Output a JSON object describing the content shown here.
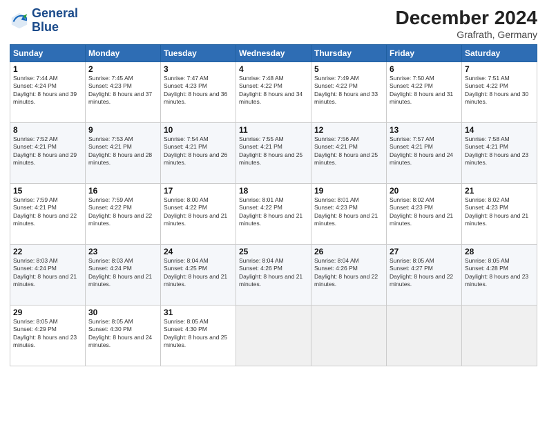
{
  "header": {
    "logo_line1": "General",
    "logo_line2": "Blue",
    "month_year": "December 2024",
    "location": "Grafrath, Germany"
  },
  "days_of_week": [
    "Sunday",
    "Monday",
    "Tuesday",
    "Wednesday",
    "Thursday",
    "Friday",
    "Saturday"
  ],
  "weeks": [
    [
      {
        "day": "1",
        "rise": "7:44 AM",
        "set": "4:24 PM",
        "daylight": "8 hours and 39 minutes."
      },
      {
        "day": "2",
        "rise": "7:45 AM",
        "set": "4:23 PM",
        "daylight": "8 hours and 37 minutes."
      },
      {
        "day": "3",
        "rise": "7:47 AM",
        "set": "4:23 PM",
        "daylight": "8 hours and 36 minutes."
      },
      {
        "day": "4",
        "rise": "7:48 AM",
        "set": "4:22 PM",
        "daylight": "8 hours and 34 minutes."
      },
      {
        "day": "5",
        "rise": "7:49 AM",
        "set": "4:22 PM",
        "daylight": "8 hours and 33 minutes."
      },
      {
        "day": "6",
        "rise": "7:50 AM",
        "set": "4:22 PM",
        "daylight": "8 hours and 31 minutes."
      },
      {
        "day": "7",
        "rise": "7:51 AM",
        "set": "4:22 PM",
        "daylight": "8 hours and 30 minutes."
      }
    ],
    [
      {
        "day": "8",
        "rise": "7:52 AM",
        "set": "4:21 PM",
        "daylight": "8 hours and 29 minutes."
      },
      {
        "day": "9",
        "rise": "7:53 AM",
        "set": "4:21 PM",
        "daylight": "8 hours and 28 minutes."
      },
      {
        "day": "10",
        "rise": "7:54 AM",
        "set": "4:21 PM",
        "daylight": "8 hours and 26 minutes."
      },
      {
        "day": "11",
        "rise": "7:55 AM",
        "set": "4:21 PM",
        "daylight": "8 hours and 25 minutes."
      },
      {
        "day": "12",
        "rise": "7:56 AM",
        "set": "4:21 PM",
        "daylight": "8 hours and 25 minutes."
      },
      {
        "day": "13",
        "rise": "7:57 AM",
        "set": "4:21 PM",
        "daylight": "8 hours and 24 minutes."
      },
      {
        "day": "14",
        "rise": "7:58 AM",
        "set": "4:21 PM",
        "daylight": "8 hours and 23 minutes."
      }
    ],
    [
      {
        "day": "15",
        "rise": "7:59 AM",
        "set": "4:21 PM",
        "daylight": "8 hours and 22 minutes."
      },
      {
        "day": "16",
        "rise": "7:59 AM",
        "set": "4:22 PM",
        "daylight": "8 hours and 22 minutes."
      },
      {
        "day": "17",
        "rise": "8:00 AM",
        "set": "4:22 PM",
        "daylight": "8 hours and 21 minutes."
      },
      {
        "day": "18",
        "rise": "8:01 AM",
        "set": "4:22 PM",
        "daylight": "8 hours and 21 minutes."
      },
      {
        "day": "19",
        "rise": "8:01 AM",
        "set": "4:23 PM",
        "daylight": "8 hours and 21 minutes."
      },
      {
        "day": "20",
        "rise": "8:02 AM",
        "set": "4:23 PM",
        "daylight": "8 hours and 21 minutes."
      },
      {
        "day": "21",
        "rise": "8:02 AM",
        "set": "4:23 PM",
        "daylight": "8 hours and 21 minutes."
      }
    ],
    [
      {
        "day": "22",
        "rise": "8:03 AM",
        "set": "4:24 PM",
        "daylight": "8 hours and 21 minutes."
      },
      {
        "day": "23",
        "rise": "8:03 AM",
        "set": "4:24 PM",
        "daylight": "8 hours and 21 minutes."
      },
      {
        "day": "24",
        "rise": "8:04 AM",
        "set": "4:25 PM",
        "daylight": "8 hours and 21 minutes."
      },
      {
        "day": "25",
        "rise": "8:04 AM",
        "set": "4:26 PM",
        "daylight": "8 hours and 21 minutes."
      },
      {
        "day": "26",
        "rise": "8:04 AM",
        "set": "4:26 PM",
        "daylight": "8 hours and 22 minutes."
      },
      {
        "day": "27",
        "rise": "8:05 AM",
        "set": "4:27 PM",
        "daylight": "8 hours and 22 minutes."
      },
      {
        "day": "28",
        "rise": "8:05 AM",
        "set": "4:28 PM",
        "daylight": "8 hours and 23 minutes."
      }
    ],
    [
      {
        "day": "29",
        "rise": "8:05 AM",
        "set": "4:29 PM",
        "daylight": "8 hours and 23 minutes."
      },
      {
        "day": "30",
        "rise": "8:05 AM",
        "set": "4:30 PM",
        "daylight": "8 hours and 24 minutes."
      },
      {
        "day": "31",
        "rise": "8:05 AM",
        "set": "4:30 PM",
        "daylight": "8 hours and 25 minutes."
      },
      null,
      null,
      null,
      null
    ]
  ]
}
